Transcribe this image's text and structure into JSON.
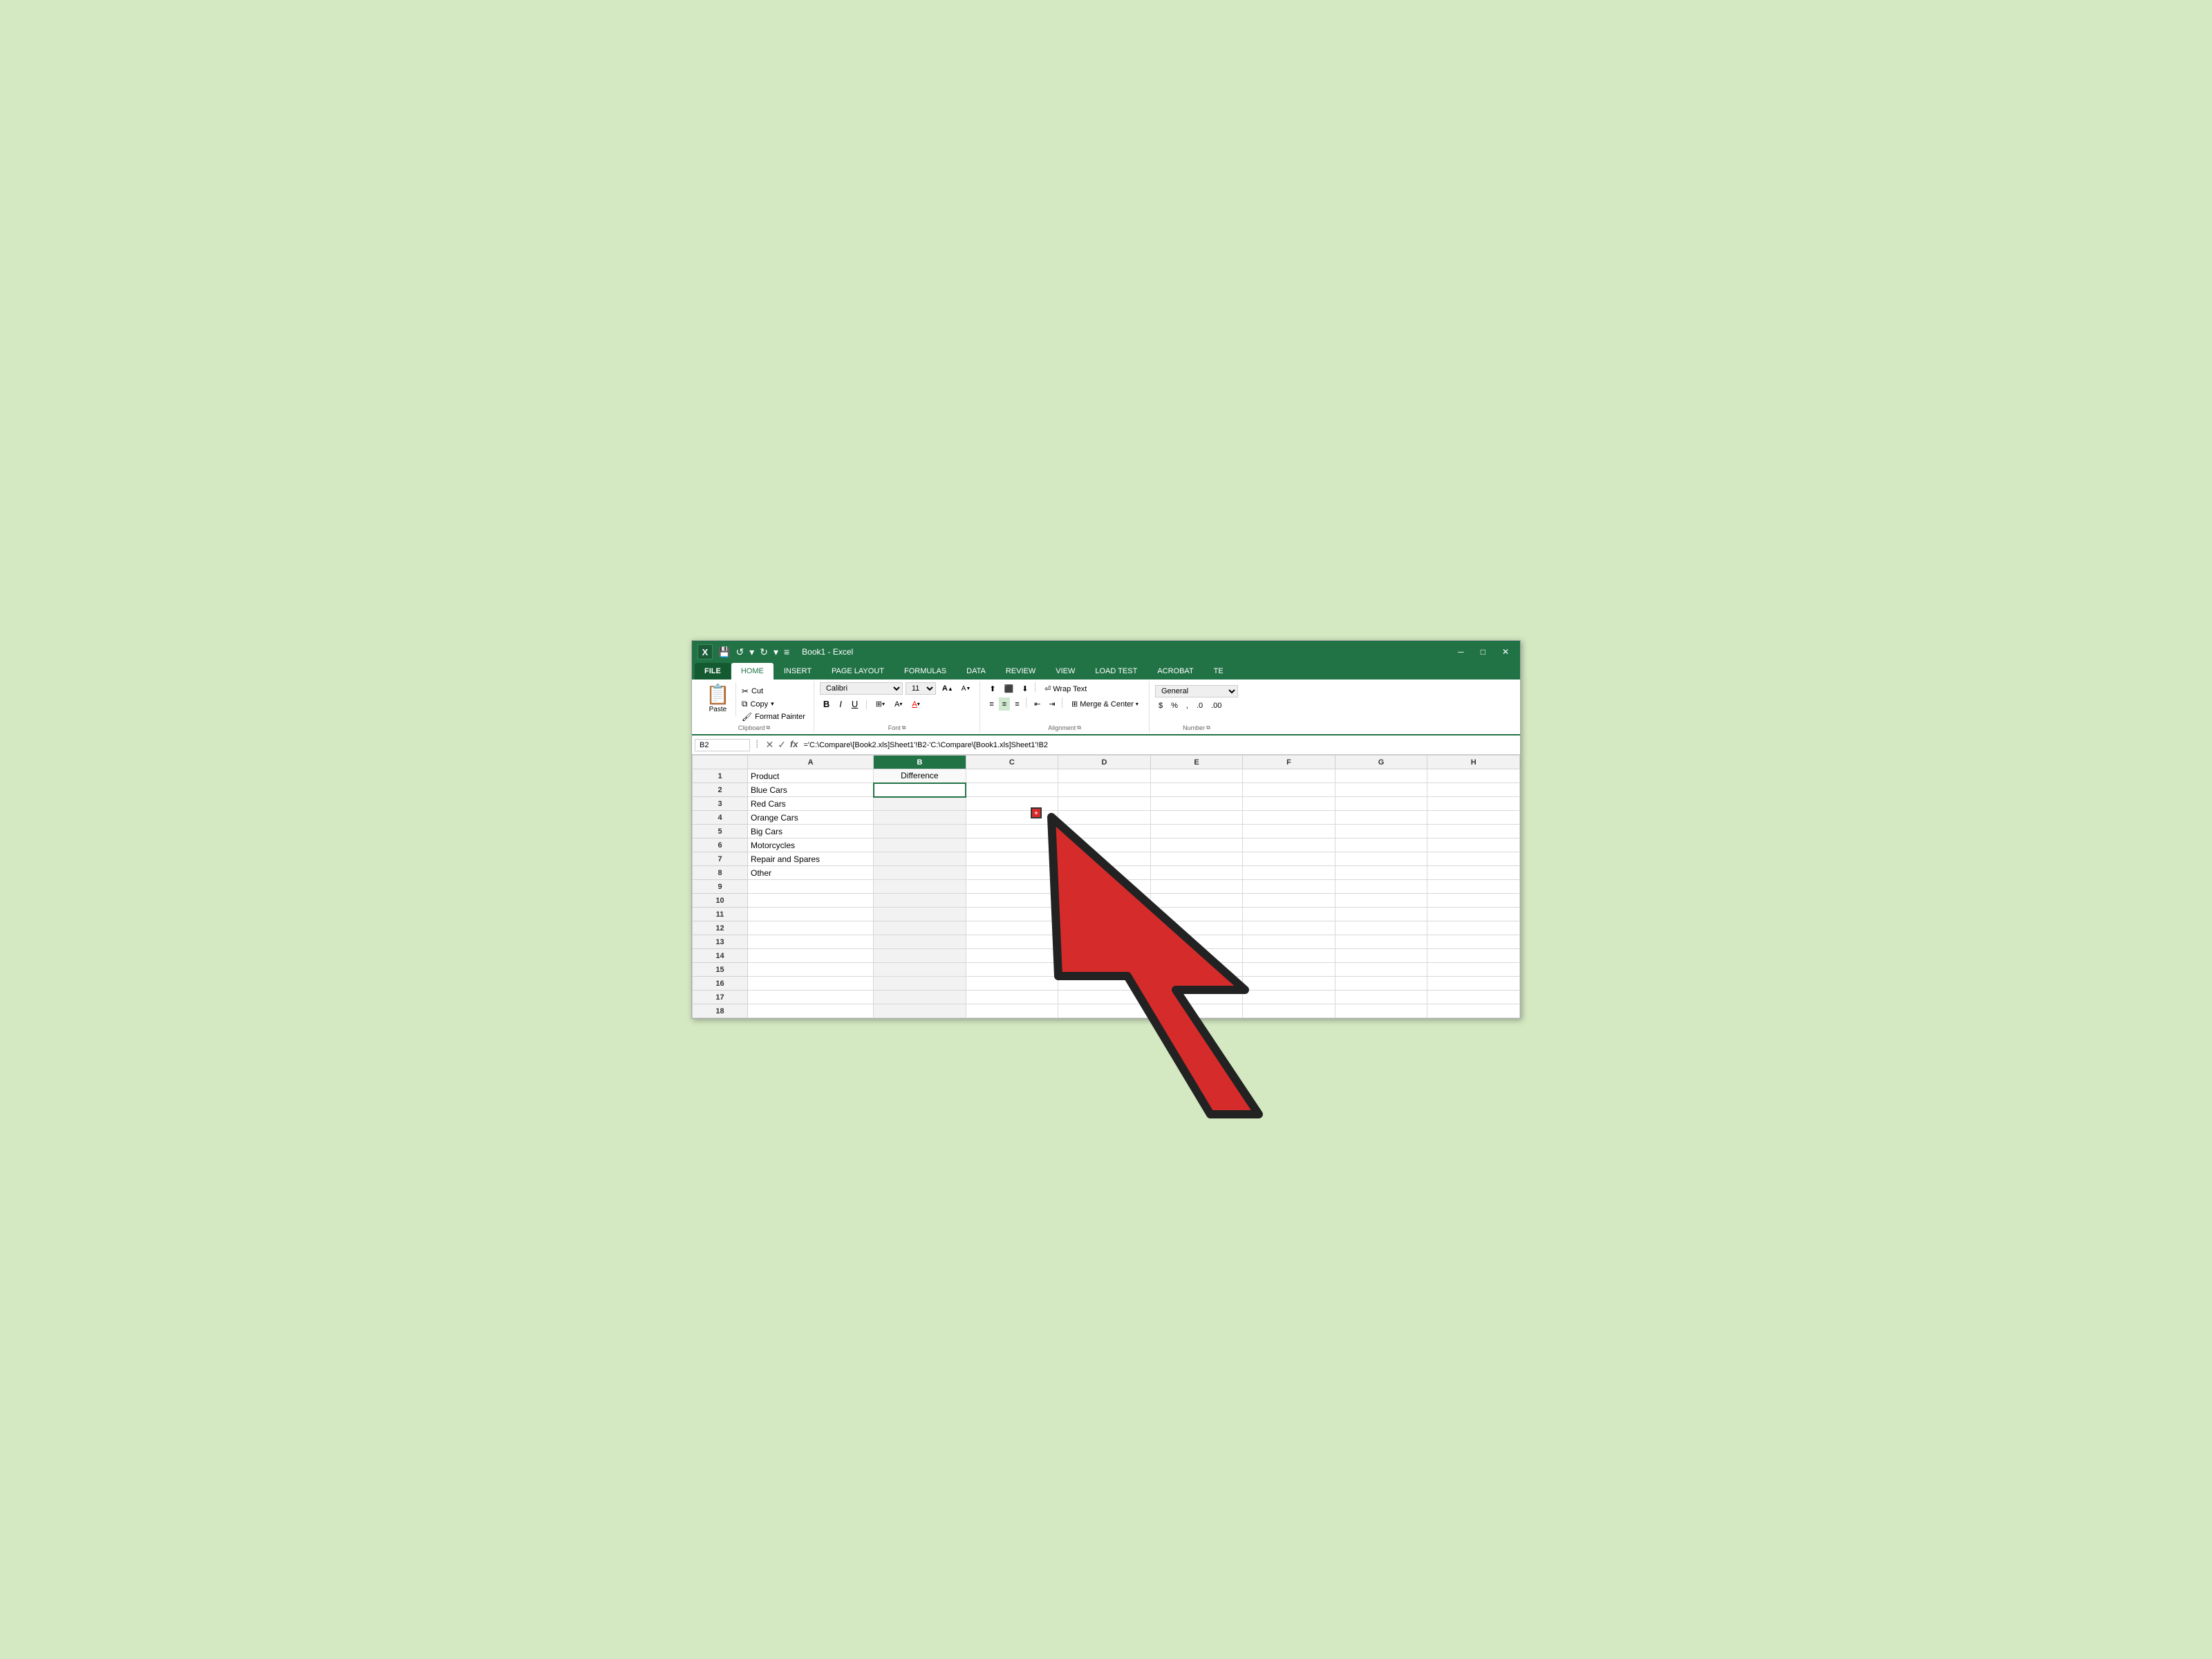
{
  "window": {
    "title": "Book1 - Excel",
    "logo": "X"
  },
  "quickaccess": {
    "save": "💾",
    "undo": "↺",
    "redo": "↻"
  },
  "tabs": [
    {
      "label": "FILE",
      "active": false,
      "file": true
    },
    {
      "label": "HOME",
      "active": true
    },
    {
      "label": "INSERT",
      "active": false
    },
    {
      "label": "PAGE LAYOUT",
      "active": false
    },
    {
      "label": "FORMULAS",
      "active": false
    },
    {
      "label": "DATA",
      "active": false
    },
    {
      "label": "REVIEW",
      "active": false
    },
    {
      "label": "VIEW",
      "active": false
    },
    {
      "label": "LOAD TEST",
      "active": false
    },
    {
      "label": "ACROBAT",
      "active": false
    },
    {
      "label": "TE",
      "active": false
    }
  ],
  "clipboard": {
    "group_label": "Clipboard",
    "paste_label": "Paste",
    "cut_label": "Cut",
    "copy_label": "Copy",
    "format_painter_label": "Format Painter"
  },
  "font": {
    "group_label": "Font",
    "font_name": "Calibri",
    "font_size": "11",
    "bold": "B",
    "italic": "I",
    "underline": "U",
    "increase_size": "A",
    "decrease_size": "A",
    "borders_label": "Borders",
    "fill_label": "Fill",
    "color_label": "Color"
  },
  "alignment": {
    "group_label": "Alignment",
    "wrap_text": "Wrap Text",
    "merge_center": "Merge & Center"
  },
  "number": {
    "group_label": "Number",
    "format": "General"
  },
  "formulabar": {
    "cell_ref": "B2",
    "formula": "='C:\\Compare\\[Book2.xls]Sheet1'!B2-'C:\\Compare\\[Book1.xls]Sheet1'!B2"
  },
  "columns": [
    "",
    "A",
    "B",
    "C",
    "D",
    "E",
    "F",
    "G",
    "H"
  ],
  "rows": [
    {
      "row": "1",
      "a": "Product",
      "b": "Difference",
      "c": "",
      "d": "",
      "e": "",
      "f": "",
      "g": "",
      "h": ""
    },
    {
      "row": "2",
      "a": "Blue Cars",
      "b": "",
      "c": "",
      "d": "",
      "e": "",
      "f": "",
      "g": "",
      "h": ""
    },
    {
      "row": "3",
      "a": "Red Cars",
      "b": "",
      "c": "",
      "d": "",
      "e": "",
      "f": "",
      "g": "",
      "h": ""
    },
    {
      "row": "4",
      "a": "Orange Cars",
      "b": "",
      "c": "",
      "d": "",
      "e": "",
      "f": "",
      "g": "",
      "h": ""
    },
    {
      "row": "5",
      "a": "Big Cars",
      "b": "",
      "c": "",
      "d": "",
      "e": "",
      "f": "",
      "g": "",
      "h": ""
    },
    {
      "row": "6",
      "a": "Motorcycles",
      "b": "",
      "c": "",
      "d": "",
      "e": "",
      "f": "",
      "g": "",
      "h": ""
    },
    {
      "row": "7",
      "a": "Repair and Spares",
      "b": "",
      "c": "",
      "d": "",
      "e": "",
      "f": "",
      "g": "",
      "h": ""
    },
    {
      "row": "8",
      "a": "Other",
      "b": "",
      "c": "",
      "d": "",
      "e": "",
      "f": "",
      "g": "",
      "h": ""
    },
    {
      "row": "9",
      "a": "",
      "b": "",
      "c": "",
      "d": "",
      "e": "",
      "f": "",
      "g": "",
      "h": ""
    },
    {
      "row": "10",
      "a": "",
      "b": "",
      "c": "",
      "d": "",
      "e": "",
      "f": "",
      "g": "",
      "h": ""
    },
    {
      "row": "11",
      "a": "",
      "b": "",
      "c": "",
      "d": "",
      "e": "",
      "f": "",
      "g": "",
      "h": ""
    },
    {
      "row": "12",
      "a": "",
      "b": "",
      "c": "",
      "d": "",
      "e": "",
      "f": "",
      "g": "",
      "h": ""
    },
    {
      "row": "13",
      "a": "",
      "b": "",
      "c": "",
      "d": "",
      "e": "",
      "f": "",
      "g": "",
      "h": ""
    },
    {
      "row": "14",
      "a": "",
      "b": "",
      "c": "",
      "d": "",
      "e": "",
      "f": "",
      "g": "",
      "h": ""
    },
    {
      "row": "15",
      "a": "",
      "b": "",
      "c": "",
      "d": "",
      "e": "",
      "f": "",
      "g": "",
      "h": ""
    },
    {
      "row": "16",
      "a": "",
      "b": "",
      "c": "",
      "d": "",
      "e": "",
      "f": "",
      "g": "",
      "h": ""
    },
    {
      "row": "17",
      "a": "",
      "b": "",
      "c": "",
      "d": "",
      "e": "",
      "f": "",
      "g": "",
      "h": ""
    },
    {
      "row": "18",
      "a": "",
      "b": "",
      "c": "",
      "d": "",
      "e": "",
      "f": "",
      "g": "",
      "h": ""
    }
  ]
}
